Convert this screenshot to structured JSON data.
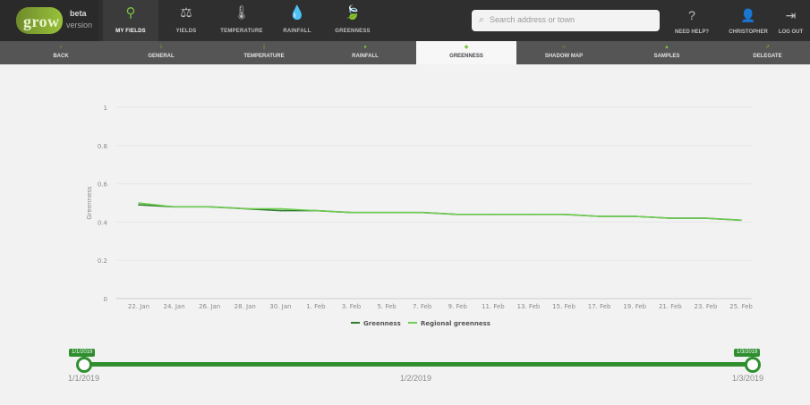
{
  "brand": {
    "word": "grow",
    "badge": "beta",
    "sub": "version"
  },
  "nav": {
    "items": [
      {
        "icon": "map-pin-icon",
        "glyph": "⚲",
        "label": "MY FIELDS",
        "active": true
      },
      {
        "icon": "scales-icon",
        "glyph": "⚖",
        "label": "YIELDS",
        "active": false
      },
      {
        "icon": "thermometer-icon",
        "glyph": "🌡",
        "label": "TEMPERATURE",
        "active": false
      },
      {
        "icon": "droplet-icon",
        "glyph": "💧",
        "label": "RAINFALL",
        "active": false
      },
      {
        "icon": "leaf-icon",
        "glyph": "🍃",
        "label": "GREENNESS",
        "active": false
      }
    ]
  },
  "search": {
    "placeholder": "Search address or town"
  },
  "right_nav": [
    {
      "icon": "help-icon",
      "glyph": "?",
      "label": "NEED HELP?"
    },
    {
      "icon": "user-icon",
      "glyph": "👤",
      "label": "CHRISTOPHER"
    },
    {
      "icon": "logout-icon",
      "glyph": "⇥",
      "label": "LOG OUT"
    }
  ],
  "tabs": [
    {
      "icon": "back-icon",
      "glyph": "‹",
      "label": "BACK",
      "active": false
    },
    {
      "icon": "info-icon",
      "glyph": "i",
      "label": "GENERAL",
      "active": false
    },
    {
      "icon": "thermometer-icon",
      "glyph": "|",
      "label": "TEMPERATURE",
      "active": false
    },
    {
      "icon": "droplet-icon",
      "glyph": "●",
      "label": "RAINFALL",
      "active": false
    },
    {
      "icon": "leaf-icon",
      "glyph": "◆",
      "label": "GREENNESS",
      "active": true
    },
    {
      "icon": "sun-icon",
      "glyph": "○",
      "label": "SHADOW MAP",
      "active": false
    },
    {
      "icon": "samples-icon",
      "glyph": "▲",
      "label": "SAMPLES",
      "active": false
    },
    {
      "icon": "share-icon",
      "glyph": "↗",
      "label": "DELEGATE",
      "active": false
    }
  ],
  "chart_data": {
    "type": "line",
    "ylabel": "Greenness",
    "ylim": [
      0,
      1
    ],
    "yticks": [
      "0",
      "0.2",
      "0.4",
      "0.6",
      "0.8",
      "1"
    ],
    "categories": [
      "22. Jan",
      "24. Jan",
      "26. Jan",
      "28. Jan",
      "30. Jan",
      "1. Feb",
      "3. Feb",
      "5. Feb",
      "7. Feb",
      "9. Feb",
      "11. Feb",
      "13. Feb",
      "15. Feb",
      "17. Feb",
      "19. Feb",
      "21. Feb",
      "23. Feb",
      "25. Feb"
    ],
    "series": [
      {
        "name": "Greenness",
        "color": "#2e7d2e",
        "values": [
          0.49,
          0.48,
          0.48,
          0.47,
          0.46,
          0.46,
          0.45,
          0.45,
          0.45,
          0.44,
          0.44,
          0.44,
          0.44,
          0.43,
          0.43,
          0.42,
          0.42,
          0.41
        ]
      },
      {
        "name": "Regional greenness",
        "color": "#6fcf4f",
        "values": [
          0.5,
          0.48,
          0.48,
          0.47,
          0.47,
          0.46,
          0.45,
          0.45,
          0.45,
          0.44,
          0.44,
          0.44,
          0.44,
          0.43,
          0.43,
          0.42,
          0.42,
          0.41
        ]
      }
    ]
  },
  "slider": {
    "start_badge": "1/1/2019",
    "end_badge": "1/3/2019",
    "labels": [
      "1/1/2019",
      "1/2/2019",
      "1/3/2019"
    ]
  }
}
